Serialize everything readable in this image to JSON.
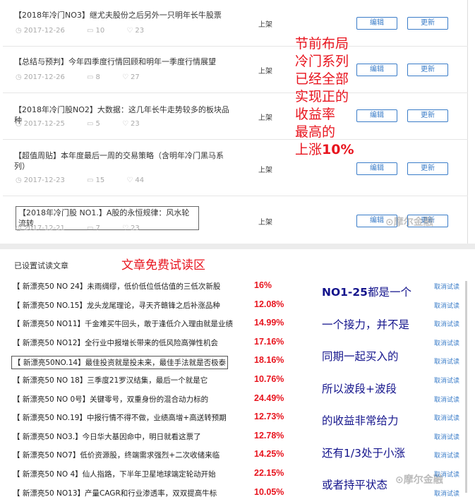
{
  "articles": [
    {
      "title": "【2018年冷门NO3】继尤夫股份之后另外一只明年长牛股票",
      "date": "2017-12-26",
      "comments": "10",
      "likes": "23",
      "status": "上架",
      "edit": "编辑",
      "update": "更新"
    },
    {
      "title": "【总结与预判】今年四季度行情回顾和明年一季度行情展望",
      "date": "2017-12-26",
      "comments": "8",
      "likes": "27",
      "status": "上架",
      "edit": "编辑",
      "update": "更新"
    },
    {
      "title": "【2018年冷门股NO2】大数据：这几年长牛走势较多的板块品种",
      "date": "2017-12-25",
      "comments": "5",
      "likes": "23",
      "status": "上架",
      "edit": "编辑",
      "update": "更新"
    },
    {
      "title": "【超值周贴】本年度最后一周的交易策略（含明年冷门黑马系列）",
      "date": "2017-12-23",
      "comments": "15",
      "likes": "44",
      "status": "上架",
      "edit": "编辑",
      "update": "更新"
    },
    {
      "title": "【2018年冷门股 NO1.】A股的永恒规律：风水轮流转",
      "date": "2017-12-21",
      "comments": "7",
      "likes": "23",
      "status": "上架",
      "edit": "编辑",
      "update": "更新"
    }
  ],
  "callout_top": {
    "lines": [
      "节前布局",
      "冷门系列",
      "已经全部",
      "实现正的",
      "收益率",
      "最高的"
    ],
    "last_prefix": "上涨",
    "last_value": "10%"
  },
  "watermark_top": "⊙摩尔金融",
  "trial": {
    "heading": "已设置试读文章",
    "zone_label": "文章免费试读区",
    "cancel_label": "取消试读",
    "rows": [
      {
        "title": "【 新漂亮50 NO 24】未雨绸缪，低价低位低估值的三低次新股",
        "pct": "16%"
      },
      {
        "title": "【 新漂亮50 NO.15】龙头龙尾理论，寻天齐赣锋之后补涨品种",
        "pct": "12.08%"
      },
      {
        "title": "【 新漂亮50 NO11】千金难买牛回头，敢于逢低介入理由就是业绩",
        "pct": "14.99%"
      },
      {
        "title": "【 新漂亮50 NO12】全行业中报增长带来的低风险高弹性机会",
        "pct": "17.16%"
      },
      {
        "title": "【 新漂亮50NO.14】最佳投资就是投未来，最佳手法就是否极泰",
        "pct": "18.16%"
      },
      {
        "title": "【 新漂亮50 NO 18】三季度21罗汉结集，最后一个就是它",
        "pct": "10.76%"
      },
      {
        "title": "【 新漂亮50 NO 0号】关键零号，双重身份的混合动力标的",
        "pct": "24.49%"
      },
      {
        "title": "【 新漂亮50 NO.19】中报行情不得不做，业绩高增+高送转预期",
        "pct": "12.73%"
      },
      {
        "title": "【 新漂亮50 NO3.】今日华大基因命中，明日就看这票了",
        "pct": "12.78%"
      },
      {
        "title": "【 新漂亮50 NO7】低价资源股，终端需求强烈+二次收储来临",
        "pct": "14.25%"
      },
      {
        "title": "【 新漂亮50 NO 4】仙人指路，下半年卫星地球端定轮动开始",
        "pct": "22.15%"
      },
      {
        "title": "【 新漂亮50 NO13】产量CAGR和行业渗透率，双双提高牛标",
        "pct": "10.05%"
      }
    ]
  },
  "callout_bottom": {
    "lines": [
      {
        "bold": "NO1-25",
        "text": "都是一个"
      },
      {
        "bold": "",
        "text": "一个接力，并不是"
      },
      {
        "bold": "",
        "text": "同期一起买入的"
      },
      {
        "bold": "",
        "text": "所以波段+波段"
      },
      {
        "bold": "",
        "text": "的收益非常给力"
      },
      {
        "bold": "",
        "text": "还有1/3处于小涨"
      },
      {
        "bold": "",
        "text": "或者持平状态"
      }
    ]
  },
  "watermark_bottom": "⊙摩尔金融",
  "colors": {
    "accent_blue": "#3a7cc8",
    "callout_red": "#e8141e",
    "callout_navy": "#14148c"
  }
}
